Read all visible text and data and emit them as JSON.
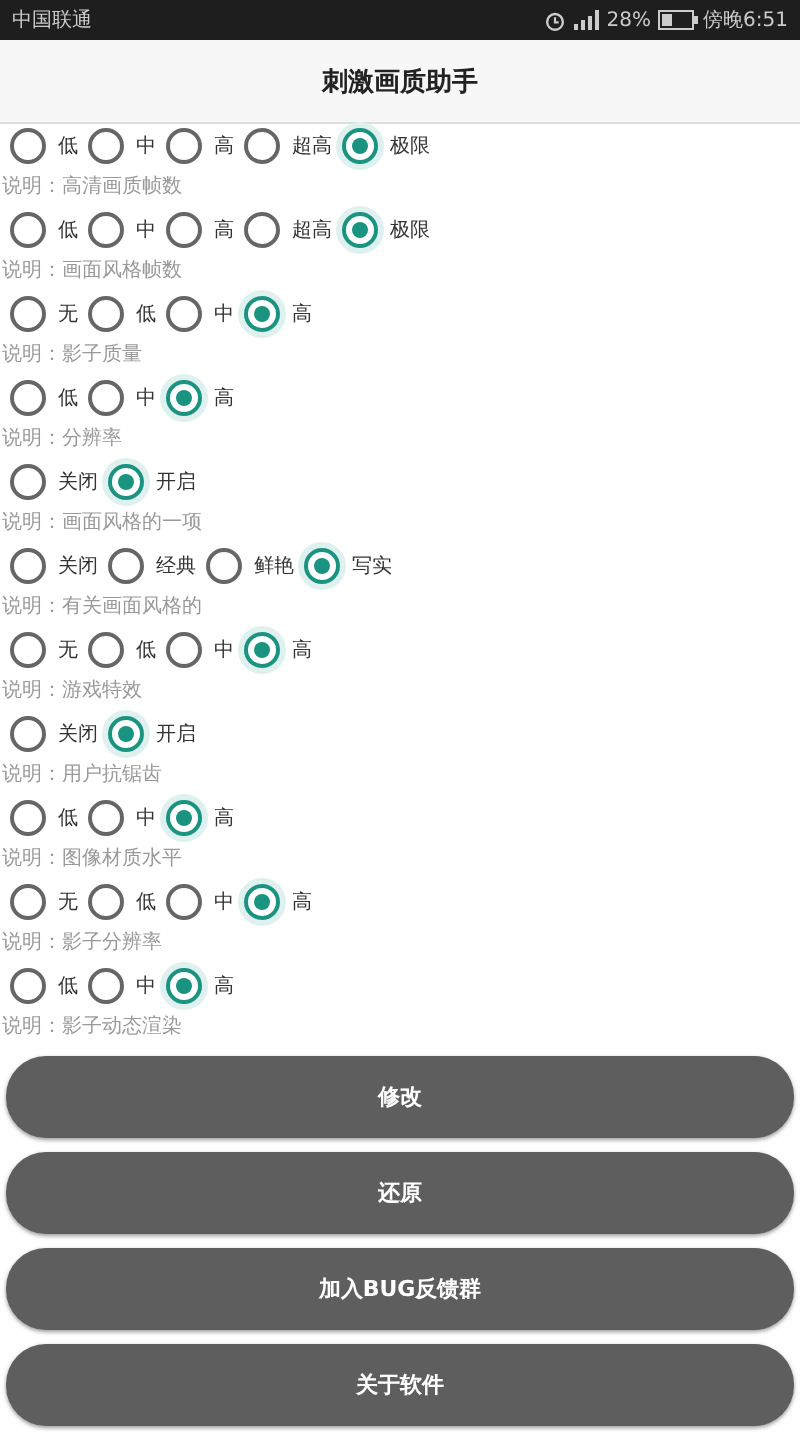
{
  "status_bar": {
    "carrier": "中国联通",
    "battery": "28%",
    "time": "傍晚6:51"
  },
  "title": "刺激画质助手",
  "settings": [
    {
      "options": [
        {
          "label": "低",
          "selected": false
        },
        {
          "label": "中",
          "selected": false
        },
        {
          "label": "高",
          "selected": false
        },
        {
          "label": "超高",
          "selected": false
        },
        {
          "label": "极限",
          "selected": true
        }
      ],
      "note": "说明：高清画质帧数"
    },
    {
      "options": [
        {
          "label": "低",
          "selected": false
        },
        {
          "label": "中",
          "selected": false
        },
        {
          "label": "高",
          "selected": false
        },
        {
          "label": "超高",
          "selected": false
        },
        {
          "label": "极限",
          "selected": true
        }
      ],
      "note": "说明：画面风格帧数"
    },
    {
      "options": [
        {
          "label": "无",
          "selected": false
        },
        {
          "label": "低",
          "selected": false
        },
        {
          "label": "中",
          "selected": false
        },
        {
          "label": "高",
          "selected": true
        }
      ],
      "note": "说明：影子质量"
    },
    {
      "options": [
        {
          "label": "低",
          "selected": false
        },
        {
          "label": "中",
          "selected": false
        },
        {
          "label": "高",
          "selected": true
        }
      ],
      "note": "说明：分辨率"
    },
    {
      "options": [
        {
          "label": "关闭",
          "selected": false
        },
        {
          "label": "开启",
          "selected": true
        }
      ],
      "note": "说明：画面风格的一项"
    },
    {
      "options": [
        {
          "label": "关闭",
          "selected": false
        },
        {
          "label": "经典",
          "selected": false
        },
        {
          "label": "鲜艳",
          "selected": false
        },
        {
          "label": "写实",
          "selected": true
        }
      ],
      "note": "说明：有关画面风格的"
    },
    {
      "options": [
        {
          "label": "无",
          "selected": false
        },
        {
          "label": "低",
          "selected": false
        },
        {
          "label": "中",
          "selected": false
        },
        {
          "label": "高",
          "selected": true
        }
      ],
      "note": "说明：游戏特效"
    },
    {
      "options": [
        {
          "label": "关闭",
          "selected": false
        },
        {
          "label": "开启",
          "selected": true
        }
      ],
      "note": "说明：用户抗锯齿"
    },
    {
      "options": [
        {
          "label": "低",
          "selected": false
        },
        {
          "label": "中",
          "selected": false
        },
        {
          "label": "高",
          "selected": true
        }
      ],
      "note": "说明：图像材质水平"
    },
    {
      "options": [
        {
          "label": "无",
          "selected": false
        },
        {
          "label": "低",
          "selected": false
        },
        {
          "label": "中",
          "selected": false
        },
        {
          "label": "高",
          "selected": true
        }
      ],
      "note": "说明：影子分辨率"
    },
    {
      "options": [
        {
          "label": "低",
          "selected": false
        },
        {
          "label": "中",
          "selected": false
        },
        {
          "label": "高",
          "selected": true
        }
      ],
      "note": "说明：影子动态渲染"
    }
  ],
  "buttons": [
    "修改",
    "还原",
    "加入BUG反馈群",
    "关于软件"
  ]
}
